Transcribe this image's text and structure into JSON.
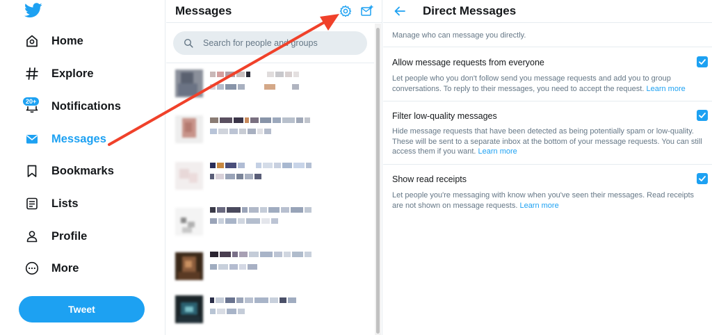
{
  "nav": {
    "items": [
      {
        "label": "Home",
        "icon": "home-icon"
      },
      {
        "label": "Explore",
        "icon": "hashtag-icon"
      },
      {
        "label": "Notifications",
        "icon": "bell-icon"
      },
      {
        "label": "Messages",
        "icon": "envelope-icon"
      },
      {
        "label": "Bookmarks",
        "icon": "bookmark-icon"
      },
      {
        "label": "Lists",
        "icon": "list-icon"
      },
      {
        "label": "Profile",
        "icon": "person-icon"
      },
      {
        "label": "More",
        "icon": "more-icon"
      }
    ],
    "notifications_badge": "20+",
    "tweet_button": "Tweet",
    "active_color": "#1da1f2"
  },
  "messages": {
    "title": "Messages",
    "search_placeholder": "Search for people and groups"
  },
  "settings": {
    "title": "Direct Messages",
    "intro": "Manage who can message you directly.",
    "options": [
      {
        "label": "Allow message requests from everyone",
        "checked": true,
        "description": "Let people who you don't follow send you message requests and add you to group conversations. To reply to their messages, you need to accept the request.",
        "link": "Learn more"
      },
      {
        "label": "Filter low-quality messages",
        "checked": true,
        "description": "Hide message requests that have been detected as being potentially spam or low-quality. These will be sent to a separate inbox at the bottom of your message requests. You can still access them if you want.",
        "link": "Learn more"
      },
      {
        "label": "Show read receipts",
        "checked": true,
        "description": "Let people you're messaging with know when you've seen their messages. Read receipts are not shown on message requests.",
        "link": "Learn more"
      }
    ]
  },
  "colors": {
    "brand": "#1da1f2",
    "annotation_arrow": "#f0412a"
  }
}
